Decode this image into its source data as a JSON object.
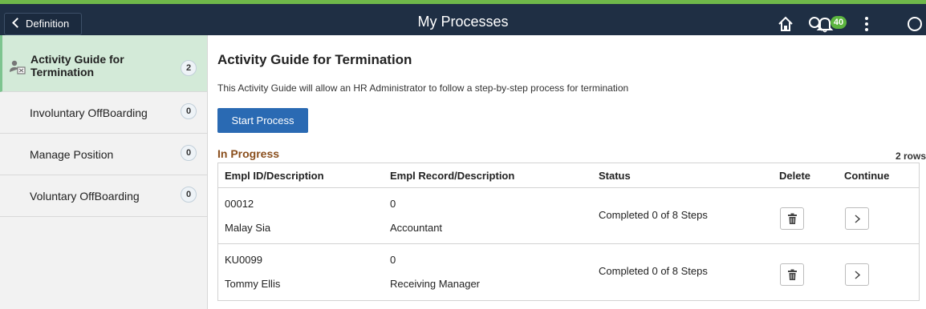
{
  "header": {
    "back_label": "Definition",
    "title": "My Processes",
    "notification_count": "40",
    "icons": [
      "home-icon",
      "search-icon",
      "notification-icon",
      "more-actions-icon",
      "navbar-icon"
    ]
  },
  "sidebar": {
    "items": [
      {
        "label": "Activity Guide for Termination",
        "count": "2",
        "active": true
      },
      {
        "label": "Involuntary OffBoarding",
        "count": "0"
      },
      {
        "label": "Manage Position",
        "count": "0"
      },
      {
        "label": "Voluntary OffBoarding",
        "count": "0"
      }
    ]
  },
  "main": {
    "title": "Activity Guide for Termination",
    "description": "This Activity Guide will allow an HR Administrator to follow a step-by-step process for termination",
    "start_button": "Start Process",
    "section_title": "In Progress",
    "rows_count": "2 rows",
    "columns": [
      "Empl ID/Description",
      "Empl Record/Description",
      "Status",
      "Delete",
      "Continue"
    ],
    "rows": [
      {
        "empl_id": "00012",
        "name": "Malay Sia",
        "record": "0",
        "record_desc": "Accountant",
        "status": "Completed 0 of 8 Steps"
      },
      {
        "empl_id": "KU0099",
        "name": "Tommy Ellis",
        "record": "0",
        "record_desc": "Receiving Manager",
        "status": "Completed 0 of 8 Steps"
      }
    ]
  },
  "colors": {
    "header_bg": "#1f2f44",
    "accent_green": "#6fb84a",
    "primary_button": "#2a6ab3",
    "section_title": "#8a4f1d",
    "active_item_bg": "#d3ead8"
  }
}
